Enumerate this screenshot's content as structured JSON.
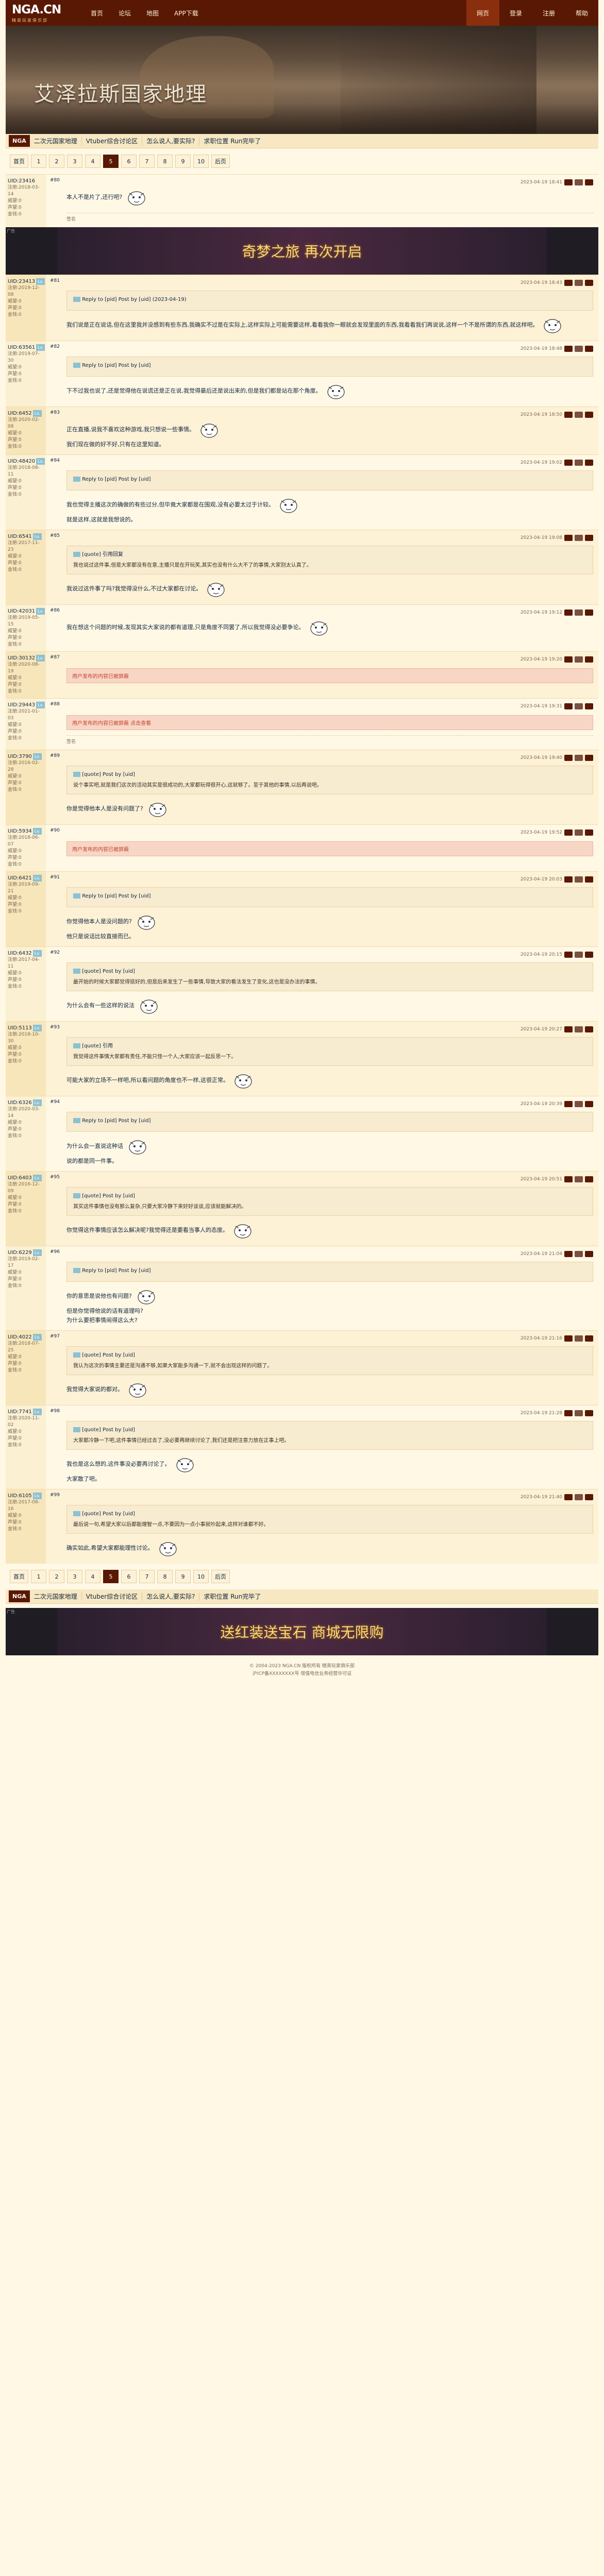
{
  "nav": {
    "logo": "NGA.CN",
    "logo_sub": "精英玩家俱乐部",
    "items": [
      "首页",
      "论坛",
      "地图",
      "APP下载"
    ],
    "right": [
      "网页",
      "登录",
      "注册",
      "帮助"
    ]
  },
  "banner": {
    "title": "艾泽拉斯国家地理"
  },
  "breadcrumbs": {
    "home": "NGA",
    "items": [
      "二次元国家地理",
      "Vtuber综合讨论区",
      "怎么说人,要实际?",
      "求职位置 Run完毕了"
    ]
  },
  "pager": {
    "first": "首页",
    "pages": [
      "1",
      "2",
      "3",
      "4",
      "5",
      "6",
      "7",
      "8",
      "9",
      "10"
    ],
    "current": "5",
    "next": "后页"
  },
  "posts": [
    {
      "id": "p1",
      "uid": "UID:23416",
      "level": "",
      "reg": "注册:2018-03-14",
      "likes": "威望:0",
      "points": "声望:0",
      "money": "金钱:0",
      "time": "2023-04-19 18:41",
      "floor": "#80",
      "text": "本人不是片了,还行吧?",
      "sig": "签名"
    },
    {
      "id": "p2",
      "uid": "UID:23413",
      "level": "Lv.",
      "reg": "注册:2019-12-08",
      "likes": "威望:0",
      "points": "声望:0",
      "money": "金钱:0",
      "time": "2023-04-19 18:43",
      "floor": "#81",
      "quote_head": "Reply to [pid] Post by [uid] (2023-04-19)",
      "text": "我们说是正在说话,但在这里我并没感到有些东西,我确实不过是在实际上,这样实际上可能需要这样,看看我你一眼就会发现里面的东西,我看看我们再说说,这样一个不是所谓的东西,就这样吧。"
    },
    {
      "id": "p3",
      "uid": "UID:63561",
      "level": "Lv.",
      "reg": "注册:2019-07-30",
      "likes": "威望:0",
      "points": "声望:0",
      "money": "金钱:0",
      "time": "2023-04-19 18:48",
      "floor": "#82",
      "quote_head": "Reply to [pid] Post by [uid]",
      "text": "下不过我也说了,还是觉得他在说谎还是正在说,我觉得最后还是说出来的,但是我们都是站在那个角度。"
    },
    {
      "id": "p4",
      "uid": "UID:6452",
      "level": "Lv.",
      "reg": "注册:2020-02-08",
      "likes": "威望:0",
      "points": "声望:0",
      "money": "金钱:0",
      "time": "2023-04-19 18:50",
      "floor": "#83",
      "text": "正在直播,说我不喜欢这种游戏,我只想说一些事情。",
      "text2": "我们现在做的好不好,只有在这里知道。"
    },
    {
      "id": "p5",
      "uid": "UID:48420",
      "level": "Lv.",
      "reg": "注册:2018-08-11",
      "likes": "威望:0",
      "points": "声望:0",
      "money": "金钱:0",
      "time": "2023-04-19 19:02",
      "floor": "#84",
      "quote_head": "Reply to [pid] Post by [uid]",
      "text": "我也觉得主播这次的确做的有些过分,但毕竟大家都是在围观,没有必要太过于计较。",
      "text2": "就是这样,这就是我想说的。"
    },
    {
      "id": "p6",
      "uid": "UID:6541",
      "level": "Lv.",
      "reg": "注册:2017-11-23",
      "likes": "威望:0",
      "points": "声望:0",
      "money": "金钱:0",
      "time": "2023-04-19 19:08",
      "floor": "#85",
      "quote_head": "[quote] 引用回复",
      "quote": "我也说过这件事,但是大家都没有在意,主播只是在开玩笑,其实也没有什么大不了的事情,大家别太认真了。",
      "text": "我说过这件事了吗?我觉得没什么,不过大家都在讨论。"
    },
    {
      "id": "p7",
      "uid": "UID:42031",
      "level": "Lv.",
      "reg": "注册:2019-05-15",
      "likes": "威望:0",
      "points": "声望:0",
      "money": "金钱:0",
      "time": "2023-04-19 19:12",
      "floor": "#86",
      "text": "我在想这个问题的时候,发现其实大家说的都有道理,只是角度不同罢了,所以我觉得没必要争论。"
    },
    {
      "id": "p8",
      "uid": "UID:30132",
      "level": "Lv.",
      "reg": "注册:2020-08-19",
      "likes": "威望:0",
      "points": "声望:0",
      "money": "金钱:0",
      "time": "2023-04-19 19:20",
      "floor": "#87",
      "notice": "用户发布的内容已被屏蔽"
    },
    {
      "id": "p9",
      "uid": "UID:29443",
      "level": "Lv.",
      "reg": "注册:2021-01-03",
      "likes": "威望:0",
      "points": "声望:0",
      "money": "金钱:0",
      "time": "2023-04-19 19:31",
      "floor": "#88",
      "notice": "用户发布的内容已被屏蔽 点击查看",
      "sig": "签名"
    },
    {
      "id": "p10",
      "uid": "UID:3790",
      "level": "Lv.",
      "reg": "注册:2016-02-28",
      "likes": "威望:0",
      "points": "声望:0",
      "money": "金钱:0",
      "time": "2023-04-19 19:40",
      "floor": "#89",
      "quote_head": "[quote] Post by [uid]",
      "quote": "说个事实吧,就是我们这次的活动其实是很成功的,大家都玩得很开心,这就够了。至于其他的事情,以后再说吧。",
      "text": "你是觉得他本人是没有问题了?"
    },
    {
      "id": "p11",
      "uid": "UID:5934",
      "level": "Lv.",
      "reg": "注册:2018-06-07",
      "likes": "威望:0",
      "points": "声望:0",
      "money": "金钱:0",
      "time": "2023-04-19 19:52",
      "floor": "#90",
      "notice": "用户发布的内容已被屏蔽"
    },
    {
      "id": "p12",
      "uid": "UID:6421",
      "level": "Lv.",
      "reg": "注册:2019-09-21",
      "likes": "威望:0",
      "points": "声望:0",
      "money": "金钱:0",
      "time": "2023-04-19 20:03",
      "floor": "#91",
      "quote_head": "Reply to [pid] Post by [uid]",
      "text": "你觉得他本人是没问题的?",
      "text2": "他只是说话比较直接而已。"
    },
    {
      "id": "p13",
      "uid": "UID:6432",
      "level": "Lv.",
      "reg": "注册:2017-04-11",
      "likes": "威望:0",
      "points": "声望:0",
      "money": "金钱:0",
      "time": "2023-04-19 20:15",
      "floor": "#92",
      "quote_head": "[quote] Post by [uid]",
      "quote": "最开始的时候大家都觉得挺好的,但是后来发生了一些事情,导致大家的看法发生了变化,这也是没办法的事情。",
      "text": "为什么会有一些这样的说法"
    },
    {
      "id": "p14",
      "uid": "UID:5113",
      "level": "Lv.",
      "reg": "注册:2018-10-30",
      "likes": "威望:0",
      "points": "声望:0",
      "money": "金钱:0",
      "time": "2023-04-19 20:27",
      "floor": "#93",
      "quote_head": "[quote] 引用",
      "quote": "我觉得这件事情大家都有责任,不能只怪一个人,大家应该一起反思一下。",
      "text": "可能大家的立场不一样吧,所以看问题的角度也不一样,这很正常。"
    },
    {
      "id": "p15",
      "uid": "UID:6326",
      "level": "Lv.",
      "reg": "注册:2020-03-14",
      "likes": "威望:0",
      "points": "声望:0",
      "money": "金钱:0",
      "time": "2023-04-19 20:39",
      "floor": "#94",
      "quote_head": "Reply to [pid] Post by [uid]",
      "text": "为什么会一直说这种话",
      "text2": "说的都是同一件事。"
    },
    {
      "id": "p16",
      "uid": "UID:6403",
      "level": "Lv.",
      "reg": "注册:2016-12-09",
      "likes": "威望:0",
      "points": "声望:0",
      "money": "金钱:0",
      "time": "2023-04-19 20:51",
      "floor": "#95",
      "quote_head": "[quote] Post by [uid]",
      "quote": "其实这件事情也没有那么复杂,只要大家冷静下来好好谈谈,应该就能解决的。",
      "text": "你觉得这件事情应该怎么解决呢?我觉得还是要看当事人的态度。"
    },
    {
      "id": "p17",
      "uid": "UID:6229",
      "level": "Lv.",
      "reg": "注册:2019-02-17",
      "likes": "威望:0",
      "points": "声望:0",
      "money": "金钱:0",
      "time": "2023-04-19 21:04",
      "floor": "#96",
      "quote_head": "Reply to [pid] Post by [uid]",
      "text": "你的意思是说他也有问题?",
      "text2": "但是你觉得他说的话有道理吗?",
      "text3": "为什么要把事情闹得这么大?"
    },
    {
      "id": "p18",
      "uid": "UID:4022",
      "level": "Lv.",
      "reg": "注册:2018-07-25",
      "likes": "威望:0",
      "points": "声望:0",
      "money": "金钱:0",
      "time": "2023-04-19 21:16",
      "floor": "#97",
      "quote_head": "[quote] Post by [uid]",
      "quote": "我认为这次的事情主要还是沟通不够,如果大家能多沟通一下,就不会出现这样的问题了。",
      "text": "我觉得大家说的都对。"
    },
    {
      "id": "p19",
      "uid": "UID:7741",
      "level": "Lv.",
      "reg": "注册:2020-11-02",
      "likes": "威望:0",
      "points": "声望:0",
      "money": "金钱:0",
      "time": "2023-04-19 21:28",
      "floor": "#98",
      "quote_head": "[quote] Post by [uid]",
      "quote": "大家都冷静一下吧,这件事情已经过去了,没必要再继续讨论了,我们还是把注意力放在正事上吧。",
      "text": "我也是这么想的,这件事没必要再讨论了。",
      "text2": "大家散了吧。"
    },
    {
      "id": "p20",
      "uid": "UID:6105",
      "level": "Lv.",
      "reg": "注册:2017-08-16",
      "likes": "威望:0",
      "points": "声望:0",
      "money": "金钱:0",
      "time": "2023-04-19 21:40",
      "floor": "#99",
      "quote_head": "[quote] Post by [uid]",
      "quote": "最后说一句,希望大家以后都能理智一点,不要因为一点小事就吵起来,这样对谁都不好。",
      "text": "确实如此,希望大家都能理性讨论。"
    }
  ],
  "ad1": {
    "text": "奇梦之旅 再次开启",
    "tag": "广告"
  },
  "ad2": {
    "text": "送红装送宝石 商城无限购",
    "tag": "广告"
  },
  "footer": {
    "line1": "© 2004-2023 NGA.CN 版权所有 精英玩家俱乐部",
    "line2": "沪ICP备XXXXXXXX号 增值电信业务经营许可证"
  }
}
